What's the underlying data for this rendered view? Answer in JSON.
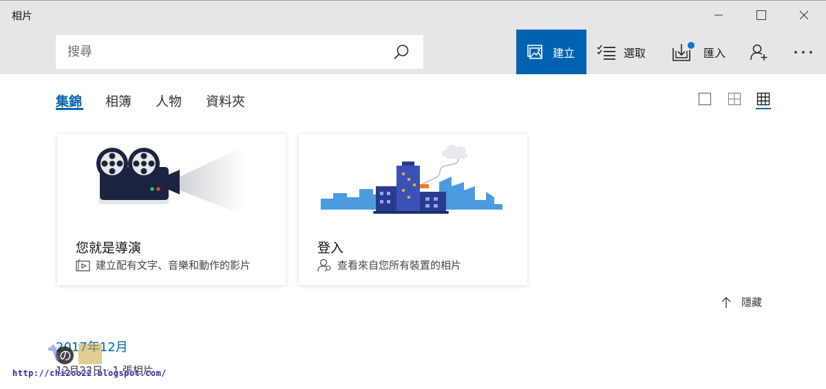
{
  "window": {
    "title": "相片"
  },
  "search": {
    "placeholder": "搜尋"
  },
  "commands": {
    "create_label": "建立",
    "select_label": "選取",
    "import_label": "匯入"
  },
  "tabs": [
    {
      "label": "集錦",
      "active": true
    },
    {
      "label": "相簿",
      "active": false
    },
    {
      "label": "人物",
      "active": false
    },
    {
      "label": "資料夾",
      "active": false
    }
  ],
  "cards": [
    {
      "title": "您就是導演",
      "subtitle": "建立配有文字、音樂和動作的影片"
    },
    {
      "title": "登入",
      "subtitle": "查看來自您所有裝置的相片"
    }
  ],
  "hide_label": "隱藏",
  "date_section": {
    "header": "2017年12月",
    "sub": "12月22日 · 1 張相片"
  },
  "watermark": {
    "url": "http://chi2oo22.blogspot.com/"
  },
  "colors": {
    "accent": "#0063b1",
    "chrome": "#e6e6e6"
  }
}
